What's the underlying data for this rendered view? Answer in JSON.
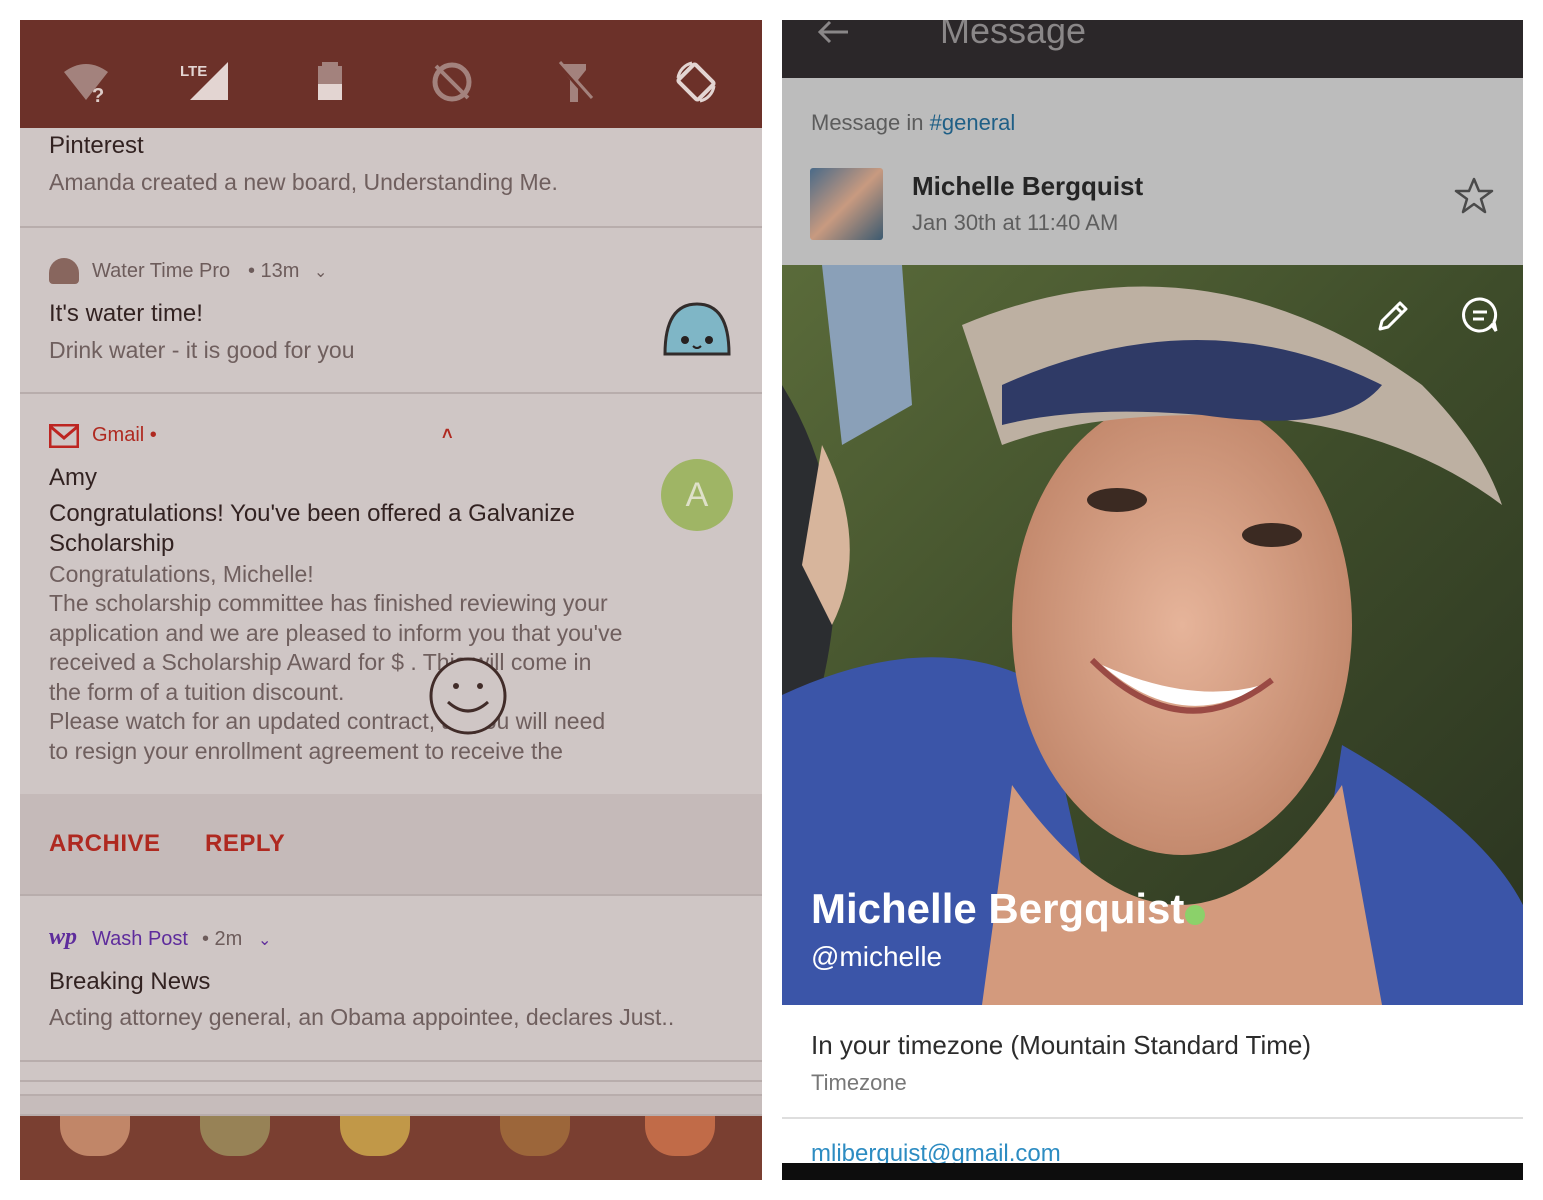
{
  "left": {
    "pinterest": {
      "app": "Pinterest",
      "body": "Amanda created a new board, Understanding Me."
    },
    "water": {
      "app": "Water Time Pro",
      "time": "• 13m",
      "title": "It's water time!",
      "body": "Drink water - it is good for you"
    },
    "gmail": {
      "app": "Gmail •",
      "sender": "Amy",
      "avatar_letter": "A",
      "subject_line1": "Congratulations! You've been offered a Galvanize",
      "subject_line2": "Scholarship",
      "body_lines": [
        "Congratulations, Michelle!",
        "The scholarship committee has finished reviewing your",
        "application and we are pleased to inform you that you've",
        "received a Scholarship Award for $     . This will come in",
        "the form of a tuition discount.",
        "Please watch for an updated contract, as you will need",
        "to resign your enrollment agreement to receive the"
      ]
    },
    "actions": {
      "archive": "ARCHIVE",
      "reply": "REPLY"
    },
    "wapo": {
      "logo": "wp",
      "app": "Wash Post",
      "time": "• 2m",
      "title": "Breaking News",
      "body": "Acting attorney general, an Obama appointee, declares Just.."
    },
    "quick_settings": [
      "wifi-unknown-icon",
      "lte-signal-icon",
      "battery-icon",
      "data-saver-off-icon",
      "flashlight-off-icon",
      "auto-rotate-icon"
    ],
    "colors": {
      "status_bar": "#6a2f27",
      "action_text": "#b5261e",
      "gmail_red": "#c5221f",
      "wapo_purple": "#5b2aa8",
      "avatar_green": "#a3c26a"
    }
  },
  "right": {
    "header_title": "Message",
    "message_in_prefix": "Message in",
    "channel": "#general",
    "sender_name": "Michelle Bergquist",
    "sender_date": "Jan 30th at 11:40 AM",
    "profile_name": "Michelle Bergquist",
    "handle": "@michelle",
    "timezone_text": "In your timezone (Mountain Standard Time)",
    "timezone_label": "Timezone",
    "email": "mliberguist@gmail.com",
    "colors": {
      "header": "#2b2729",
      "channel_link": "#1f5f86",
      "online": "#8bd16a",
      "email_link": "#2d8cc2"
    }
  }
}
